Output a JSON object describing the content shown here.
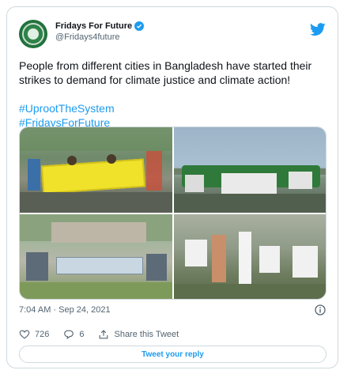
{
  "header": {
    "display_name": "Fridays For Future",
    "handle": "@Fridays4future",
    "avatar_icon": "fridays-for-future-logo",
    "verified_icon": "verified-badge-icon",
    "platform_icon": "twitter-bird-icon"
  },
  "tweet": {
    "text": "People from different cities in Bangladesh have started their strikes to demand for climate justice and climate action!",
    "hashtags": [
      "#UprootTheSystem",
      "#FridaysForFuture"
    ]
  },
  "media": {
    "photos": [
      "protest-march-banner",
      "group-with-placards-by-river",
      "group-with-banner-outdoors",
      "group-with-signs-on-grass"
    ]
  },
  "meta": {
    "timestamp": "7:04 AM · Sep 24, 2021",
    "info_icon": "info-icon"
  },
  "actions": {
    "like_count": "726",
    "reply_count": "6",
    "share_label": "Share this Tweet"
  },
  "reply_button": {
    "label": "Tweet your reply"
  },
  "colors": {
    "accent": "#1d9bf0",
    "text": "#0f1419",
    "muted": "#536471",
    "border": "#cfd9de"
  }
}
